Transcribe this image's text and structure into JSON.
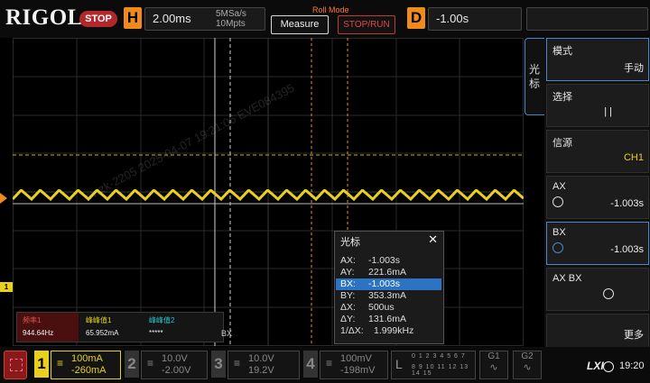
{
  "brand": "RIGOL",
  "status": "STOP",
  "horizontal": {
    "label": "H",
    "timebase": "2.00ms",
    "sample_rate": "5MSa/s",
    "mem_depth": "10Mpts"
  },
  "roll_mode": "Roll Mode",
  "buttons": {
    "measure": "Measure",
    "stop_run": "STOP/RUN"
  },
  "delay": {
    "label": "D",
    "value": "-1.00s"
  },
  "watermark": "ewzk-2205 2025-04-07 19:21:06 EVE084395",
  "menu": {
    "tab_title": "光标",
    "items": [
      {
        "label": "模式",
        "value": "手动"
      },
      {
        "label": "选择",
        "value": "| |"
      },
      {
        "label": "信源",
        "value": "CH1"
      },
      {
        "label": "AX",
        "value": "-1.003s"
      },
      {
        "label": "BX",
        "value": "-1.003s"
      },
      {
        "label": "AX BX",
        "value": ""
      },
      {
        "label": "",
        "value": "更多"
      }
    ]
  },
  "cursor_popup": {
    "title": "光标",
    "close": "✕",
    "rows": [
      {
        "k": "AX:",
        "v": "-1.003s"
      },
      {
        "k": "AY:",
        "v": "221.6mA"
      },
      {
        "k": "BX:",
        "v": "-1.003s"
      },
      {
        "k": "BY:",
        "v": "353.3mA"
      },
      {
        "k": "ΔX:",
        "v": "500us"
      },
      {
        "k": "ΔY:",
        "v": "131.6mA"
      },
      {
        "k": "1/ΔX:",
        "v": "1.999kHz"
      }
    ]
  },
  "measurements": [
    {
      "name": "频率1",
      "value": "944.64Hz",
      "color": "#e05050"
    },
    {
      "name": "峰峰值1",
      "value": "65.952mA",
      "color": "#e8d01c"
    },
    {
      "name": "峰峰值2",
      "value": "*****",
      "color": "#26c6d6"
    }
  ],
  "bx_tag": "BX",
  "channels": [
    {
      "num": "1",
      "coupling": "≡",
      "scale": "100mA",
      "offset": "-260mA",
      "color": "#e8d01c",
      "active": true
    },
    {
      "num": "2",
      "coupling": "≡",
      "scale": "10.0V",
      "offset": "-2.00V",
      "color": "#777",
      "active": false
    },
    {
      "num": "3",
      "coupling": "≡",
      "scale": "10.0V",
      "offset": "19.2V",
      "color": "#777",
      "active": false
    },
    {
      "num": "4",
      "coupling": "≡",
      "scale": "100mV",
      "offset": "-198mV",
      "color": "#777",
      "active": false
    }
  ],
  "la": {
    "label": "L",
    "digits1": "0 1 2 3  4 5 6 7",
    "digits2": "8 9 10 11 12 13 14 15"
  },
  "generators": [
    "G1",
    "G2"
  ],
  "ch1_marker": "1",
  "time": "19:20",
  "colors": {
    "accent": "#f08a1a",
    "trace": "#e8d01c",
    "selection": "#2c73c4"
  }
}
